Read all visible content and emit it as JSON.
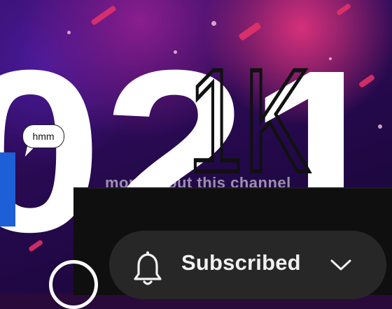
{
  "banner": {
    "digits": "021",
    "overlay_mark": "1K",
    "caption_fragment": "more about this channel",
    "hmm_bubble": "hmm"
  },
  "subscribe": {
    "label": "Subscribed",
    "bell_icon": "bell-icon",
    "chevron_icon": "chevron-down-icon"
  },
  "colors": {
    "pill_bg": "#272727",
    "panel_bg": "#0f0f0f",
    "banner_accent": "#e8336a",
    "banner_bg": "#2a0a3a",
    "blue_block": "#1d5fd6"
  }
}
